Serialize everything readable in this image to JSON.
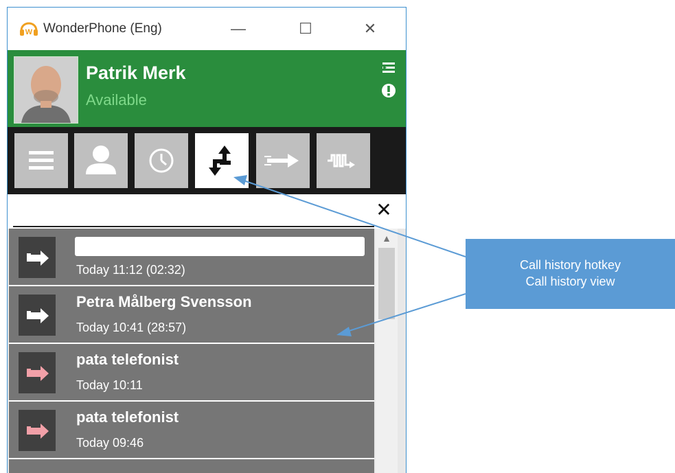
{
  "window": {
    "title": "WonderPhone (Eng)",
    "minimize_glyph": "—",
    "maximize_glyph": "☐",
    "close_glyph": "✕"
  },
  "header": {
    "name": "Patrik Merk",
    "status": "Available",
    "background_color": "#2a8d3d",
    "status_color": "#7fd98a"
  },
  "toolbar": {
    "buttons": [
      {
        "icon": "menu-icon",
        "active": false
      },
      {
        "icon": "contact-icon",
        "active": false
      },
      {
        "icon": "clock-icon",
        "active": false
      },
      {
        "icon": "call-history-icon",
        "active": true
      },
      {
        "icon": "forward-icon",
        "active": false
      },
      {
        "icon": "voicemail-icon",
        "active": false
      }
    ]
  },
  "search": {
    "value": "",
    "clear_glyph": "✕"
  },
  "call_history": [
    {
      "name": "",
      "time": "Today 11:12 (02:32)",
      "direction": "outgoing",
      "redacted": true
    },
    {
      "name": "Petra Målberg Svensson",
      "time": "Today 10:41 (28:57)",
      "direction": "outgoing"
    },
    {
      "name": "pata telefonist",
      "time": "Today 10:11",
      "direction": "missed"
    },
    {
      "name": "pata telefonist",
      "time": "Today 09:46",
      "direction": "missed"
    }
  ],
  "callout": {
    "line1": "Call history hotkey",
    "line2": "Call history view",
    "color": "#5b9bd5"
  }
}
